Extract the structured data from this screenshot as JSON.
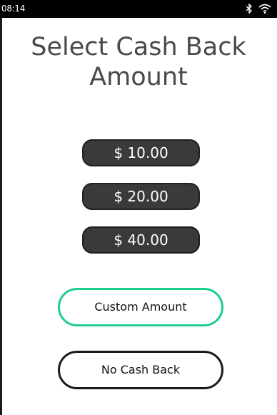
{
  "status_bar": {
    "time": "08:14",
    "icons": [
      "bluetooth-icon",
      "wifi-icon"
    ]
  },
  "title": {
    "line1": "Select Cash Back",
    "line2": "Amount"
  },
  "amount_options": [
    {
      "label": "$ 10.00"
    },
    {
      "label": "$ 20.00"
    },
    {
      "label": "$ 40.00"
    }
  ],
  "custom_amount": {
    "label": "Custom Amount"
  },
  "no_cash_back": {
    "label": "No Cash Back"
  },
  "colors": {
    "accent": "#1ecf8c",
    "amount_button": "#3a3a3a",
    "status_bar": "#000000"
  }
}
